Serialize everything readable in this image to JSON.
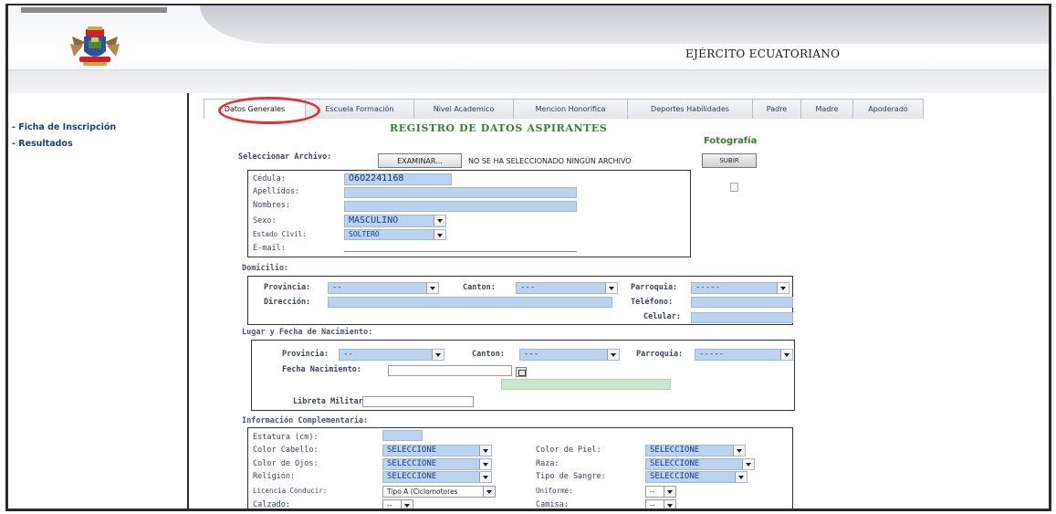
{
  "header": {
    "title": "EJÉRCITO ECUATORIANO"
  },
  "sidebar": {
    "items": [
      {
        "label": "- Ficha de Inscripción"
      },
      {
        "label": "- Resultados"
      }
    ]
  },
  "tabs": [
    {
      "label": "Datos Generales",
      "active": true
    },
    {
      "label": "Escuela Formación"
    },
    {
      "label": "Nivel Academico"
    },
    {
      "label": "Mencion Honorifica"
    },
    {
      "label": "Deportes Habilidades"
    },
    {
      "label": "Padre"
    },
    {
      "label": "Madre"
    },
    {
      "label": "Apoderado"
    }
  ],
  "form": {
    "title": "REGISTRO DE DATOS ASPIRANTES",
    "photo_title": "Fotografía",
    "file": {
      "label": "Seleccionar Archivo:",
      "browse_button": "EXAMINAR...",
      "status": "NO SE HA SELECCIONADO NINGÚN ARCHIVO",
      "upload_button": "SUBIR"
    },
    "personal": {
      "cedula_label": "Cédula:",
      "cedula_value": "0602241168",
      "apellidos_label": "Apellidos:",
      "nombres_label": "Nombres:",
      "sexo_label": "Sexo:",
      "sexo_value": "MASCULINO",
      "estado_civil_label": "Estado Civil:",
      "estado_civil_value": "SOLTERO",
      "email_label": "E-mail:"
    },
    "domicilio": {
      "title": "Domicilio:",
      "provincia_label": "Provincia:",
      "provincia_value": "--",
      "canton_label": "Canton:",
      "canton_value": "---",
      "parroquia_label": "Parroquia:",
      "parroquia_value": "-----",
      "direccion_label": "Dirección:",
      "telefono_label": "Teléfono:",
      "celular_label": "Celular:"
    },
    "nacimiento": {
      "title": "Lugar y Fecha de Nacimiento:",
      "provincia_label": "Provincia:",
      "provincia_value": "--",
      "canton_label": "Canton:",
      "canton_value": "---",
      "parroquia_label": "Parroquia:",
      "parroquia_value": "-----",
      "fecha_label": "Fecha Nacimiento:",
      "libreta_label": "Libreta Militar:"
    },
    "complementaria": {
      "title": "Información Complementaria:",
      "estatura_label": "Estatura (cm):",
      "color_cabello_label": "Color Cabello:",
      "color_cabello_value": "SELECCIONE",
      "color_piel_label": "Color de Piel:",
      "color_piel_value": "SELECCIONE",
      "color_ojos_label": "Color de Ojos:",
      "color_ojos_value": "SELECCIONE",
      "raza_label": "Raza:",
      "raza_value": "SELECCIONE",
      "religion_label": "Religión:",
      "religion_value": "SELECCIONE",
      "tipo_sangre_label": "Tipo de Sangre:",
      "tipo_sangre_value": "SELECCIONE",
      "licencia_label": "Licencia Conducir:",
      "licencia_value": "Tipo A (Ciclomotores",
      "uniforme_label": "Uniforme:",
      "uniforme_value": "--",
      "calzado_label": "Calzado:",
      "calzado_value": "--",
      "camisa_label": "Camisa:",
      "camisa_value": "--"
    }
  },
  "colors": {
    "active_tab_highlight": "#e53232",
    "form_title": "#3d7d2e",
    "field_fill": "#bcd3f0",
    "sidebar_link": "#1f3d8a"
  }
}
